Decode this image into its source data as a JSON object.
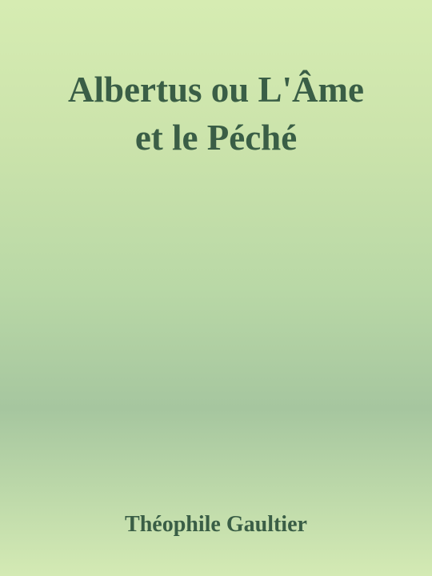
{
  "cover": {
    "title_line1": "Albertus ou L'Âme",
    "title_line2": "et le Péché",
    "author": "Théophile Gaultier"
  }
}
